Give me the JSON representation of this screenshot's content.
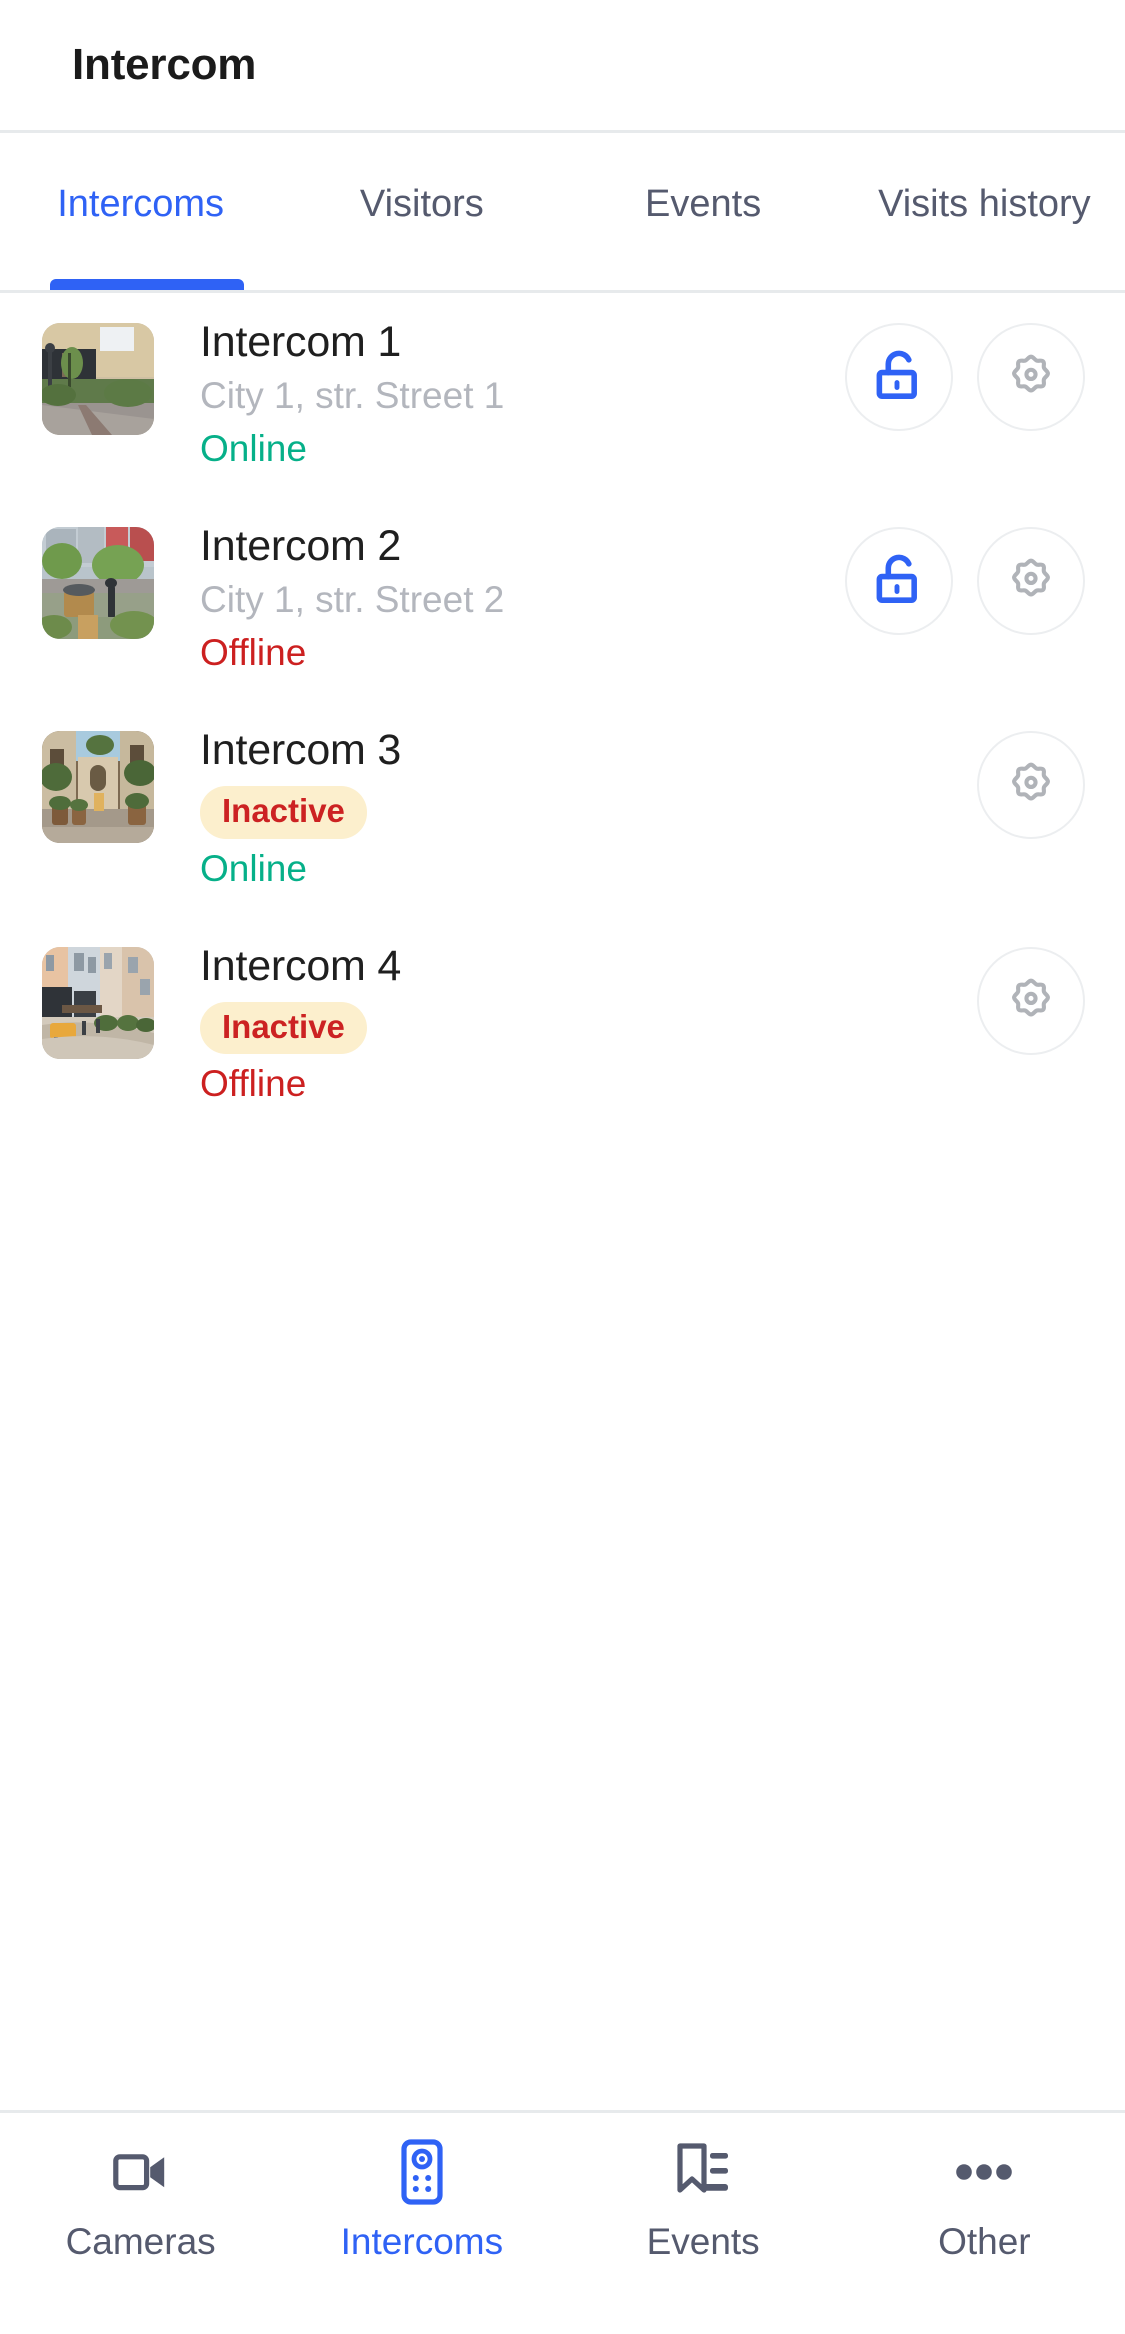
{
  "header": {
    "title": "Intercom"
  },
  "tabs": {
    "active_index": 0,
    "items": [
      {
        "label": "Intercoms"
      },
      {
        "label": "Visitors"
      },
      {
        "label": "Events"
      },
      {
        "label": "Visits history"
      }
    ]
  },
  "colors": {
    "accent": "#2f62f5",
    "online": "#06b089",
    "offline": "#cc2020",
    "badge_bg": "#fcefcd",
    "badge_text": "#cc2222",
    "muted_text": "#b3b6bd",
    "icon_gray": "#b0b3b8",
    "divider": "#e7eaec"
  },
  "list": {
    "items": [
      {
        "title": "Intercom 1",
        "subtitle": "City 1, str. Street 1",
        "badge": "",
        "status": "Online",
        "status_kind": "online",
        "thumbnail_name": "intercom-1-thumbnail",
        "has_unlock": true,
        "has_settings": true,
        "unlock_icon": "unlock-icon",
        "settings_icon": "gear-icon"
      },
      {
        "title": "Intercom 2",
        "subtitle": "City 1, str. Street 2",
        "badge": "",
        "status": "Offline",
        "status_kind": "offline",
        "thumbnail_name": "intercom-2-thumbnail",
        "has_unlock": true,
        "has_settings": true,
        "unlock_icon": "unlock-icon",
        "settings_icon": "gear-icon"
      },
      {
        "title": "Intercom 3",
        "subtitle": "",
        "badge": "Inactive",
        "status": "Online",
        "status_kind": "online",
        "thumbnail_name": "intercom-3-thumbnail",
        "has_unlock": false,
        "has_settings": true,
        "unlock_icon": "",
        "settings_icon": "gear-icon"
      },
      {
        "title": "Intercom 4",
        "subtitle": "",
        "badge": "Inactive",
        "status": "Offline",
        "status_kind": "offline",
        "thumbnail_name": "intercom-4-thumbnail",
        "has_unlock": false,
        "has_settings": true,
        "unlock_icon": "",
        "settings_icon": "gear-icon"
      }
    ]
  },
  "bottom_nav": {
    "active_index": 1,
    "items": [
      {
        "label": "Cameras",
        "icon": "video-camera-icon"
      },
      {
        "label": "Intercoms",
        "icon": "intercom-panel-icon"
      },
      {
        "label": "Events",
        "icon": "bookmark-list-icon"
      },
      {
        "label": "Other",
        "icon": "more-dots-icon"
      }
    ]
  }
}
